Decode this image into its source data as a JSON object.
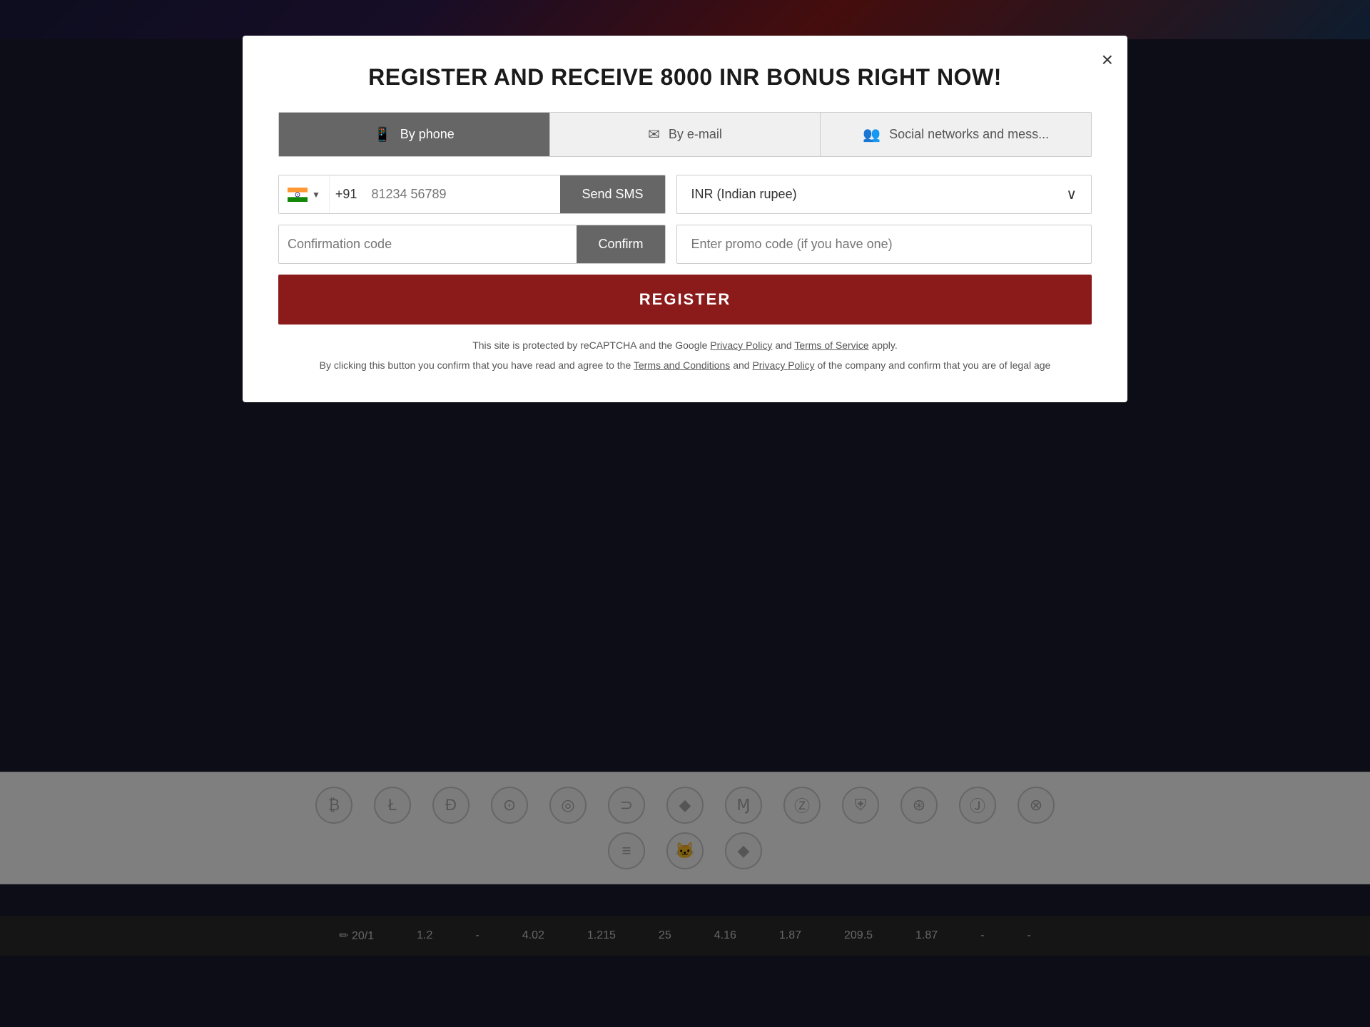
{
  "modal": {
    "title": "REGISTER AND RECEIVE 8000 INR BONUS RIGHT NOW!",
    "close_label": "×",
    "tabs": [
      {
        "id": "phone",
        "label": "By phone",
        "icon": "📱",
        "active": true
      },
      {
        "id": "email",
        "label": "By e-mail",
        "icon": "✉"
      },
      {
        "id": "social",
        "label": "Social networks and mess...",
        "icon": "👥"
      }
    ],
    "phone_field": {
      "country_code": "+91",
      "placeholder": "81234 56789",
      "send_sms_label": "Send SMS"
    },
    "currency_select": {
      "value": "INR (Indian rupee)"
    },
    "confirmation_field": {
      "placeholder": "Confirmation code",
      "confirm_label": "Confirm"
    },
    "promo_field": {
      "placeholder": "Enter promo code (if you have one)"
    },
    "register_label": "REGISTER",
    "legal1": "This site is protected by reCAPTCHA and the Google",
    "privacy_policy": "Privacy Policy",
    "and1": "and",
    "terms_of_service": "Terms of Service",
    "apply": "apply.",
    "legal2_pre": "By clicking this button you confirm that you have read and agree to the",
    "terms_conditions": "Terms and Conditions",
    "and2": "and",
    "privacy_policy2": "Privacy Policy",
    "legal2_post": "of the company and confirm that you are of legal age"
  },
  "crypto_icons": [
    "₿",
    "Ł",
    "Ð",
    "⊙",
    "◎",
    "⊃",
    "◆",
    "Ɱ",
    "ⓩ",
    "⛨",
    "⊛",
    "Ⓙ",
    "⊗"
  ],
  "crypto_row2": [
    "≡",
    "🐱",
    "◆"
  ],
  "ticker": [
    {
      "label": "20/1",
      "value": "1.2"
    },
    {
      "label": "-",
      "value": "4.02"
    },
    {
      "label": "1.215",
      "value": "25"
    },
    {
      "label": "4.16",
      "value": "1.87"
    },
    {
      "label": "209.5",
      "value": "1.87"
    },
    {
      "label": "-",
      "value": "-"
    }
  ]
}
